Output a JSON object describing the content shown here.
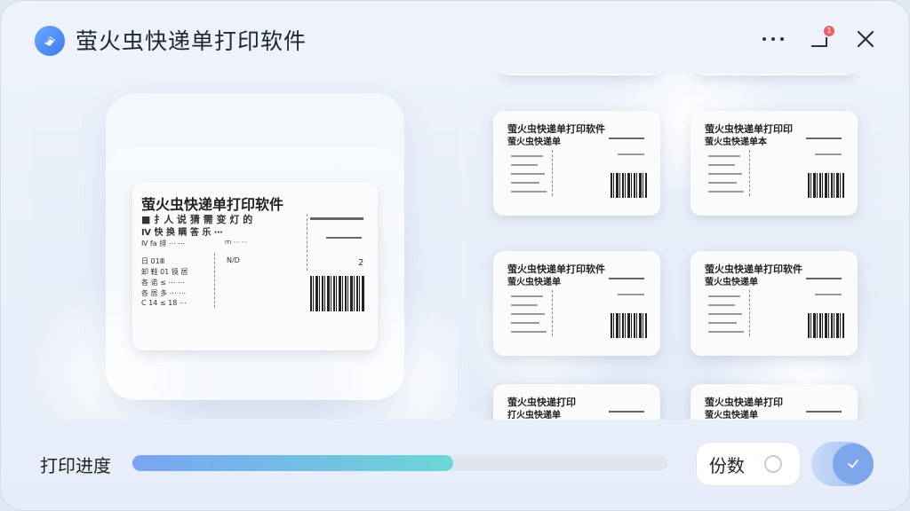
{
  "app": {
    "title": "萤火虫快递单打印软件",
    "notification_count": "1"
  },
  "icons": {
    "logo": "app-logo-icon",
    "more": "more-horizontal-icon",
    "minimize": "minimize-icon",
    "close": "close-icon",
    "confirm": "check-icon"
  },
  "main_label": {
    "title": "萤火虫快递单打印软件",
    "line1": "■ 扌人 说 猜 需 变 灯 的",
    "line2": "Ⅳ 快 换 瞒 答 乐 ⋯",
    "line3": "Ⅳ  fa 排  ⋯  ⋯",
    "line4": "日 01Ⅲ",
    "line5": "卸 鞋 01 镜 居",
    "line6": "各 诺 ≤  ⋯  ⋯",
    "line7": "各 居 多  ⋯  ⋯",
    "line8": "C 14 ≤ 18 ⋯",
    "right1": "rn ⋯ ⋯",
    "right2": "N/D",
    "right3": "2"
  },
  "thumbnails": [
    {
      "title": "萤火虫快递单打印软件",
      "subtitle": "萤火虫快递单"
    },
    {
      "title": "萤火虫快递单打印印",
      "subtitle": "萤火虫快递单本"
    },
    {
      "title": "萤火虫快递单打印软件",
      "subtitle": "萤火虫快递单"
    },
    {
      "title": "萤火虫快递单打印软件",
      "subtitle": "萤火虫快递单"
    },
    {
      "title": "萤火虫快递打印",
      "subtitle": "打火虫快递单"
    },
    {
      "title": "萤火虫快递单打印",
      "subtitle": "萤火虫快递单"
    }
  ],
  "progress": {
    "label": "打印进度",
    "value": 0.6
  },
  "copies": {
    "label": "份数"
  },
  "colors": {
    "accent": "#7ea6ea",
    "progress_start": "#7aa4f3",
    "progress_end": "#6cd6d6"
  }
}
